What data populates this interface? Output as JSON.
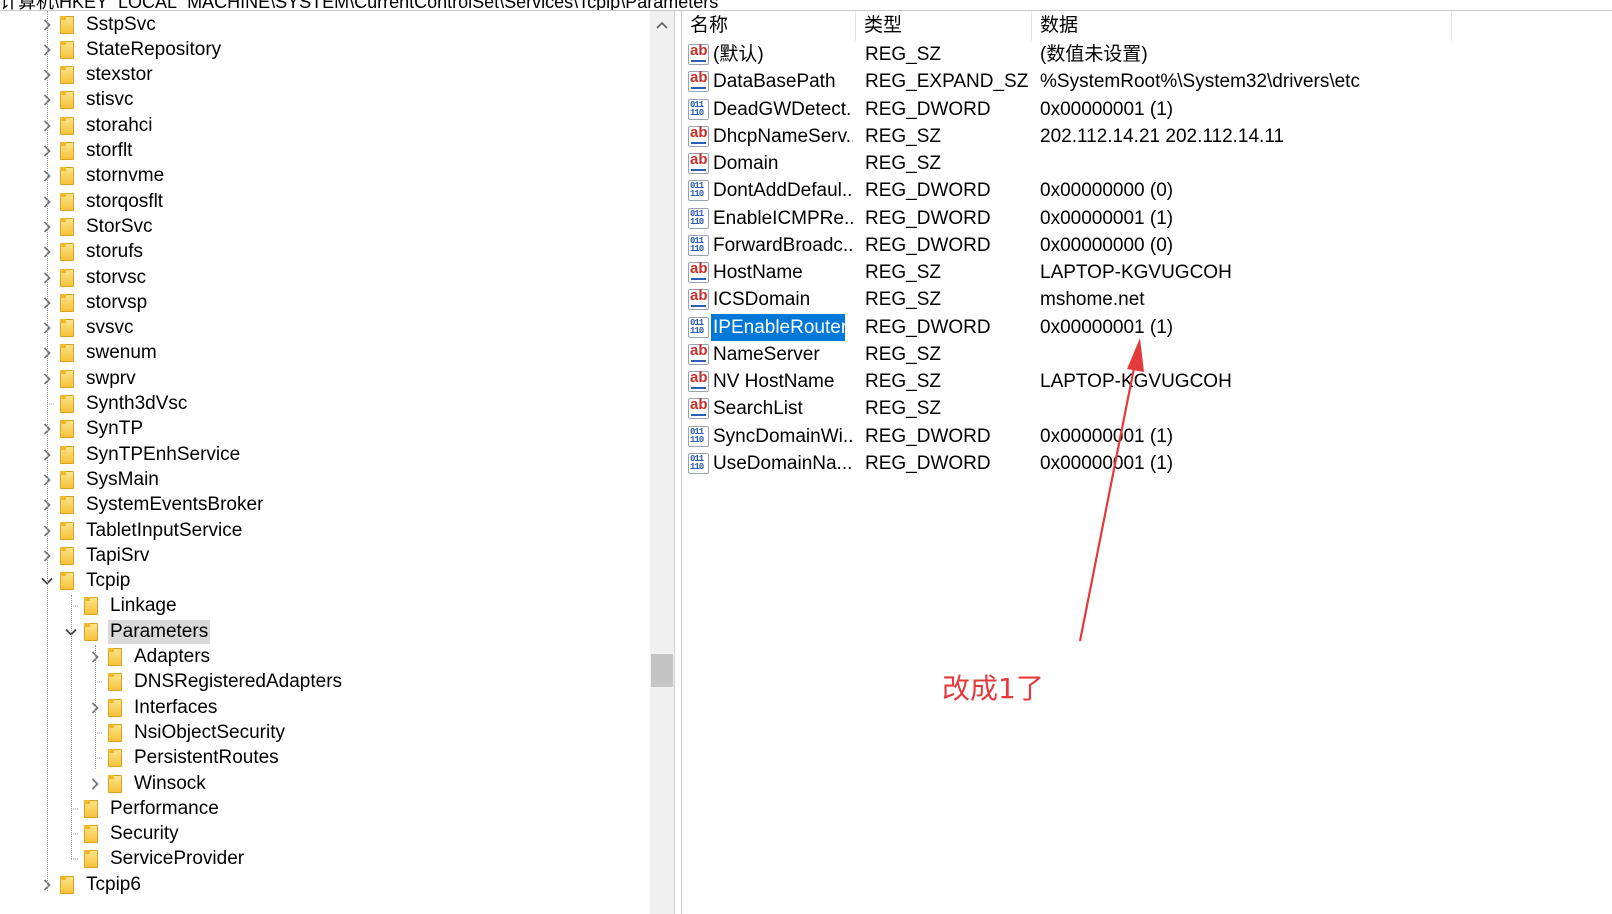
{
  "address_bar": {
    "path": "计算机\\HKEY_LOCAL_MACHINE\\SYSTEM\\CurrentControlSet\\Services\\Tcpip\\Parameters"
  },
  "tree": {
    "items": [
      {
        "label": "SstpSvc",
        "level": 0,
        "expander": "collapsed"
      },
      {
        "label": "StateRepository",
        "level": 0,
        "expander": "collapsed"
      },
      {
        "label": "stexstor",
        "level": 0,
        "expander": "collapsed"
      },
      {
        "label": "stisvc",
        "level": 0,
        "expander": "collapsed"
      },
      {
        "label": "storahci",
        "level": 0,
        "expander": "collapsed"
      },
      {
        "label": "storflt",
        "level": 0,
        "expander": "collapsed"
      },
      {
        "label": "stornvme",
        "level": 0,
        "expander": "collapsed"
      },
      {
        "label": "storqosflt",
        "level": 0,
        "expander": "collapsed"
      },
      {
        "label": "StorSvc",
        "level": 0,
        "expander": "collapsed"
      },
      {
        "label": "storufs",
        "level": 0,
        "expander": "collapsed"
      },
      {
        "label": "storvsc",
        "level": 0,
        "expander": "collapsed"
      },
      {
        "label": "storvsp",
        "level": 0,
        "expander": "collapsed"
      },
      {
        "label": "svsvc",
        "level": 0,
        "expander": "collapsed"
      },
      {
        "label": "swenum",
        "level": 0,
        "expander": "collapsed"
      },
      {
        "label": "swprv",
        "level": 0,
        "expander": "collapsed"
      },
      {
        "label": "Synth3dVsc",
        "level": 0,
        "expander": "none"
      },
      {
        "label": "SynTP",
        "level": 0,
        "expander": "collapsed"
      },
      {
        "label": "SynTPEnhService",
        "level": 0,
        "expander": "collapsed"
      },
      {
        "label": "SysMain",
        "level": 0,
        "expander": "collapsed"
      },
      {
        "label": "SystemEventsBroker",
        "level": 0,
        "expander": "collapsed"
      },
      {
        "label": "TabletInputService",
        "level": 0,
        "expander": "collapsed"
      },
      {
        "label": "TapiSrv",
        "level": 0,
        "expander": "collapsed"
      },
      {
        "label": "Tcpip",
        "level": 0,
        "expander": "expanded"
      },
      {
        "label": "Linkage",
        "level": 1,
        "expander": "none"
      },
      {
        "label": "Parameters",
        "level": 1,
        "expander": "expanded",
        "selected": true
      },
      {
        "label": "Adapters",
        "level": 2,
        "expander": "collapsed"
      },
      {
        "label": "DNSRegisteredAdapters",
        "level": 2,
        "expander": "none"
      },
      {
        "label": "Interfaces",
        "level": 2,
        "expander": "collapsed"
      },
      {
        "label": "NsiObjectSecurity",
        "level": 2,
        "expander": "none"
      },
      {
        "label": "PersistentRoutes",
        "level": 2,
        "expander": "none"
      },
      {
        "label": "Winsock",
        "level": 2,
        "expander": "collapsed"
      },
      {
        "label": "Performance",
        "level": 1,
        "expander": "none"
      },
      {
        "label": "Security",
        "level": 1,
        "expander": "none"
      },
      {
        "label": "ServiceProvider",
        "level": 1,
        "expander": "none"
      },
      {
        "label": "Tcpip6",
        "level": 0,
        "expander": "collapsed"
      }
    ]
  },
  "list": {
    "headers": {
      "name": "名称",
      "type": "类型",
      "data": "数据"
    },
    "rows": [
      {
        "icon": "string-value-icon",
        "name": "(默认)",
        "type": "REG_SZ",
        "data": "(数值未设置)"
      },
      {
        "icon": "string-value-icon",
        "name": "DataBasePath",
        "type": "REG_EXPAND_SZ",
        "data": "%SystemRoot%\\System32\\drivers\\etc"
      },
      {
        "icon": "binary-value-icon",
        "name": "DeadGWDetect...",
        "type": "REG_DWORD",
        "data": "0x00000001 (1)"
      },
      {
        "icon": "string-value-icon",
        "name": "DhcpNameServ...",
        "type": "REG_SZ",
        "data": "202.112.14.21 202.112.14.11"
      },
      {
        "icon": "string-value-icon",
        "name": "Domain",
        "type": "REG_SZ",
        "data": ""
      },
      {
        "icon": "binary-value-icon",
        "name": "DontAddDefaul...",
        "type": "REG_DWORD",
        "data": "0x00000000 (0)"
      },
      {
        "icon": "binary-value-icon",
        "name": "EnableICMPRe...",
        "type": "REG_DWORD",
        "data": "0x00000001 (1)"
      },
      {
        "icon": "binary-value-icon",
        "name": "ForwardBroadc...",
        "type": "REG_DWORD",
        "data": "0x00000000 (0)"
      },
      {
        "icon": "string-value-icon",
        "name": "HostName",
        "type": "REG_SZ",
        "data": "LAPTOP-KGVUGCOH"
      },
      {
        "icon": "string-value-icon",
        "name": "ICSDomain",
        "type": "REG_SZ",
        "data": "mshome.net"
      },
      {
        "icon": "binary-value-icon",
        "name": "IPEnableRouter",
        "type": "REG_DWORD",
        "data": "0x00000001 (1)",
        "selected": true
      },
      {
        "icon": "string-value-icon",
        "name": "NameServer",
        "type": "REG_SZ",
        "data": ""
      },
      {
        "icon": "string-value-icon",
        "name": "NV HostName",
        "type": "REG_SZ",
        "data": "LAPTOP-KGVUGCOH"
      },
      {
        "icon": "string-value-icon",
        "name": "SearchList",
        "type": "REG_SZ",
        "data": ""
      },
      {
        "icon": "binary-value-icon",
        "name": "SyncDomainWi...",
        "type": "REG_DWORD",
        "data": "0x00000001 (1)"
      },
      {
        "icon": "binary-value-icon",
        "name": "UseDomainNa...",
        "type": "REG_DWORD",
        "data": "0x00000001 (1)"
      }
    ]
  },
  "annotation": {
    "text": "改成1了",
    "color": "#e33b3b"
  },
  "colors": {
    "selection": "#0078d7",
    "tree_selection": "#d9d9d9",
    "folder": "#f7c23c"
  }
}
